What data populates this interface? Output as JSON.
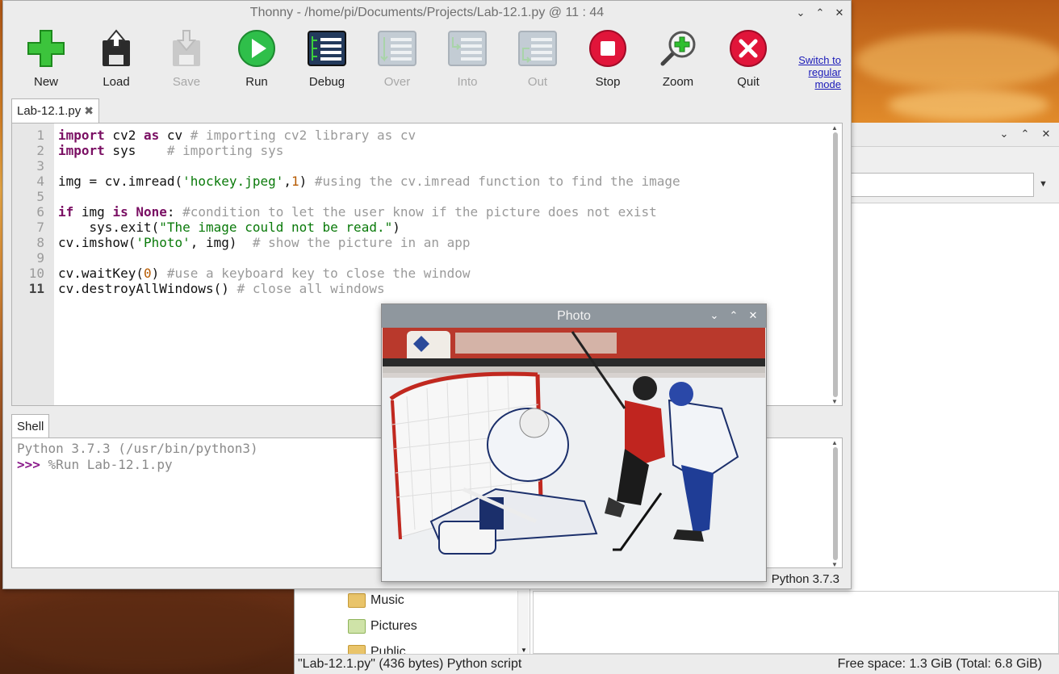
{
  "file_manager": {
    "sidebar_items": [
      "Music",
      "Pictures",
      "Public"
    ],
    "status_left": "\"Lab-12.1.py\" (436 bytes) Python script",
    "status_right": "Free space: 1.3 GiB (Total: 6.8 GiB)"
  },
  "thonny": {
    "title": "Thonny  -  /home/pi/Documents/Projects/Lab-12.1.py  @  11 : 44",
    "toolbar": [
      {
        "label": "New",
        "icon": "new-icon",
        "enabled": true
      },
      {
        "label": "Load",
        "icon": "load-icon",
        "enabled": true
      },
      {
        "label": "Save",
        "icon": "save-icon",
        "enabled": false
      },
      {
        "label": "Run",
        "icon": "run-icon",
        "enabled": true
      },
      {
        "label": "Debug",
        "icon": "debug-icon",
        "enabled": true
      },
      {
        "label": "Over",
        "icon": "step-over-icon",
        "enabled": false
      },
      {
        "label": "Into",
        "icon": "step-into-icon",
        "enabled": false
      },
      {
        "label": "Out",
        "icon": "step-out-icon",
        "enabled": false
      },
      {
        "label": "Stop",
        "icon": "stop-icon",
        "enabled": true
      },
      {
        "label": "Zoom",
        "icon": "zoom-icon",
        "enabled": true
      },
      {
        "label": "Quit",
        "icon": "quit-icon",
        "enabled": true
      }
    ],
    "switch_mode_link": "Switch to regular mode",
    "editor_tab": "Lab-12.1.py",
    "line_numbers": [
      "1",
      "2",
      "3",
      "4",
      "5",
      "6",
      "7",
      "8",
      "9",
      "10",
      "11"
    ],
    "code_lines": [
      "import cv2 as cv # importing cv2 library as cv",
      "import sys    # importing sys",
      "",
      "img = cv.imread('hockey.jpeg',1) #using the cv.imread function to find the image",
      "",
      "if img is None: #condition to let the user know if the picture does not exist",
      "    sys.exit(\"The image could not be read.\")",
      "cv.imshow('Photo', img)  # show the picture in an app",
      "",
      "cv.waitKey(0) #use a keyboard key to close the window",
      "cv.destroyAllWindows() # close all windows"
    ],
    "shell_tab": "Shell",
    "shell_lines": [
      "Python 3.7.3 (/usr/bin/python3)",
      "%Run Lab-12.1.py"
    ],
    "shell_prompt": ">>>",
    "interpreter_status": "Python 3.7.3"
  },
  "photo_window": {
    "title": "Photo"
  },
  "colors": {
    "keyword": "#7a0f63",
    "string": "#0a7a0a",
    "number": "#b65a00",
    "comment": "#9a9a9a",
    "link": "#1a1ab8"
  }
}
